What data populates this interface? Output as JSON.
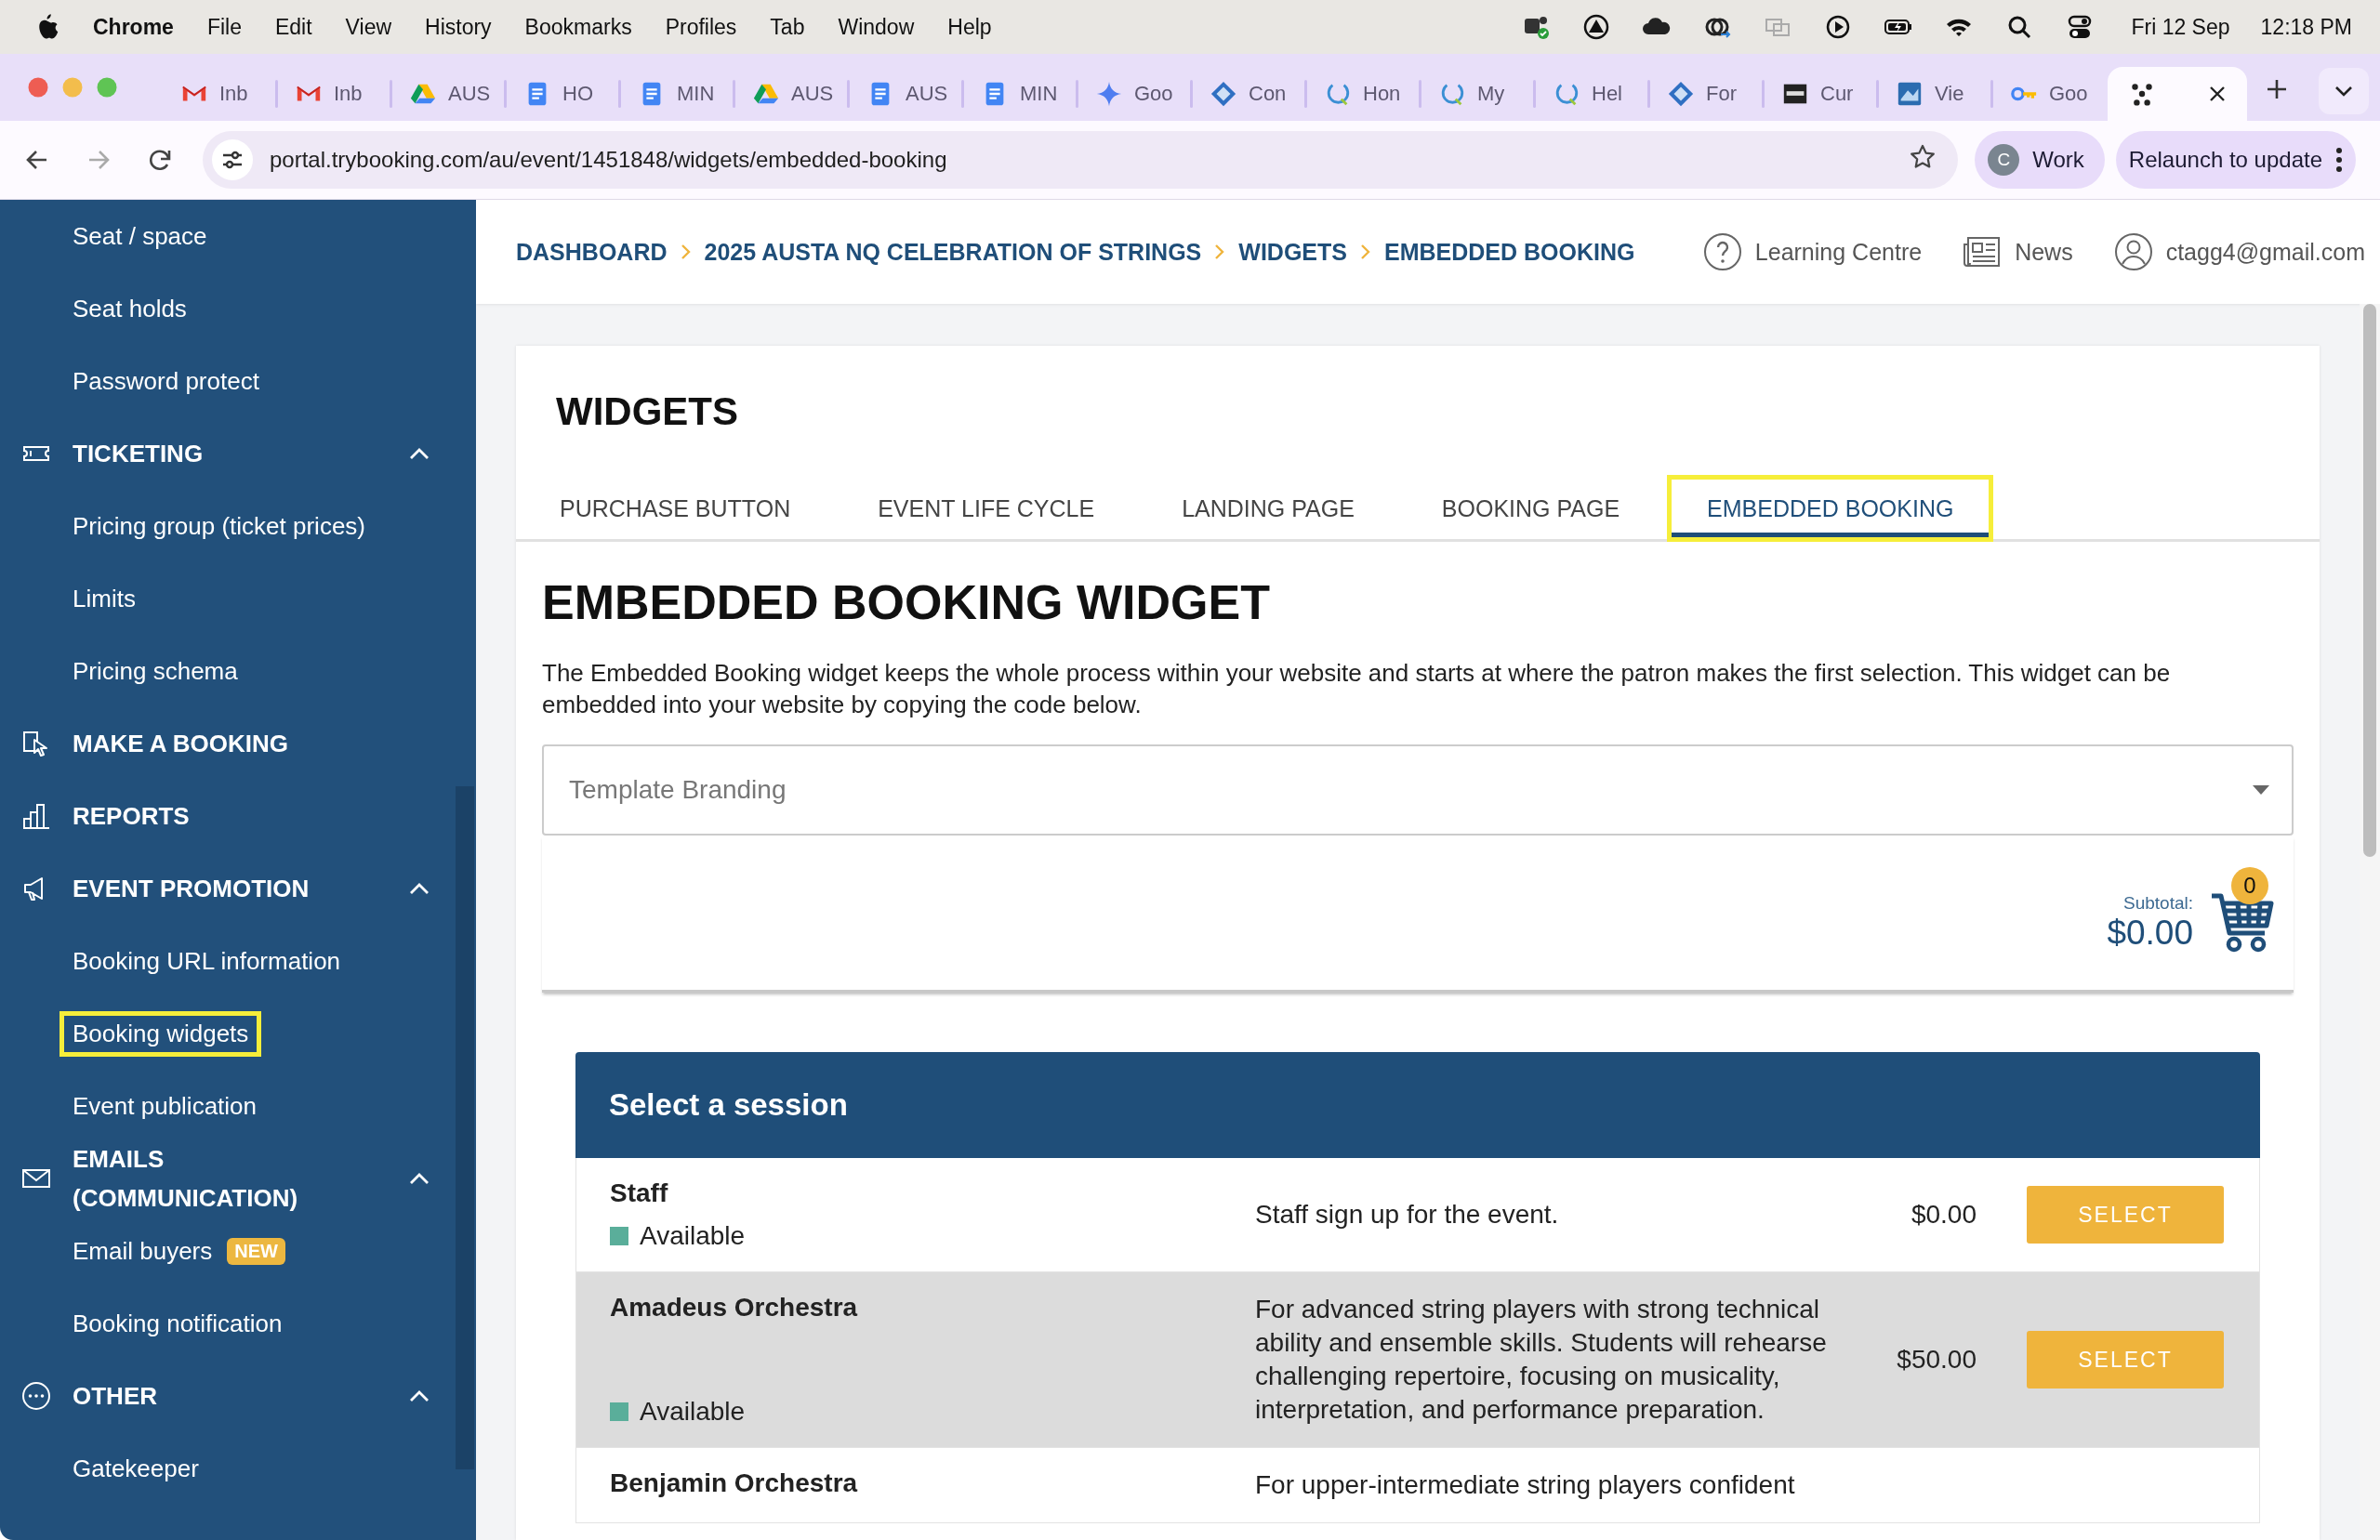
{
  "menu_bar": {
    "app": "Chrome",
    "menus": [
      "File",
      "Edit",
      "View",
      "History",
      "Bookmarks",
      "Profiles",
      "Tab",
      "Window",
      "Help"
    ],
    "date": "Fri 12 Sep",
    "time": "12:18 PM"
  },
  "browser_tabs": [
    {
      "title": "Inb",
      "selected": false
    },
    {
      "title": "Inb",
      "selected": false
    },
    {
      "title": "AUS",
      "selected": false
    },
    {
      "title": "HO",
      "selected": false
    },
    {
      "title": "MIN",
      "selected": false
    },
    {
      "title": "AUS",
      "selected": false
    },
    {
      "title": "AUS",
      "selected": false
    },
    {
      "title": "MIN",
      "selected": false
    },
    {
      "title": "Goo",
      "selected": false
    },
    {
      "title": "Con",
      "selected": false
    },
    {
      "title": "Hon",
      "selected": false
    },
    {
      "title": "My",
      "selected": false
    },
    {
      "title": "Hel",
      "selected": false
    },
    {
      "title": "For",
      "selected": false
    },
    {
      "title": "Cur",
      "selected": false
    },
    {
      "title": "Vie",
      "selected": false
    },
    {
      "title": "Goo",
      "selected": false
    },
    {
      "selected": true
    }
  ],
  "address_bar": {
    "url": "portal.trybooking.com/au/event/1451848/widgets/embedded-booking",
    "profile_initial": "C",
    "profile_name": "Work",
    "update_button": "Relaunch to update"
  },
  "sidebar": {
    "items": [
      {
        "kind": "link",
        "label": "Seat / space",
        "highlighted": false
      },
      {
        "kind": "link",
        "label": "Seat holds",
        "highlighted": false
      },
      {
        "kind": "link",
        "label": "Password protect",
        "highlighted": false
      },
      {
        "kind": "section",
        "label": "TICKETING",
        "expanded": true,
        "children": [
          {
            "label": "Pricing group (ticket prices)",
            "highlighted": false
          },
          {
            "label": "Limits",
            "highlighted": false
          },
          {
            "label": "Pricing schema",
            "highlighted": false
          }
        ]
      },
      {
        "kind": "entry",
        "label": "MAKE A BOOKING"
      },
      {
        "kind": "entry",
        "label": "REPORTS"
      },
      {
        "kind": "section",
        "label": "EVENT PROMOTION",
        "expanded": true,
        "children": [
          {
            "label": "Booking URL information",
            "highlighted": false
          },
          {
            "label": "Booking widgets",
            "highlighted": true
          },
          {
            "label": "Event publication",
            "highlighted": false
          }
        ]
      },
      {
        "kind": "section",
        "label": "EMAILS (COMMUNICATION)",
        "expanded": true,
        "children": [
          {
            "label": "Email buyers",
            "badge": "NEW",
            "highlighted": false
          },
          {
            "label": "Booking notification",
            "highlighted": false
          }
        ]
      },
      {
        "kind": "section",
        "label": "OTHER",
        "expanded": true,
        "children": [
          {
            "label": "Gatekeeper",
            "highlighted": false
          }
        ]
      }
    ]
  },
  "breadcrumb": [
    "DASHBOARD",
    "2025 AUSTA NQ CELEBRATION OF STRINGS",
    "WIDGETS",
    "EMBEDDED BOOKING"
  ],
  "header_links": [
    "Learning Centre",
    "News",
    "ctagg4@gmail.com"
  ],
  "widgets": {
    "title": "WIDGETS",
    "tabs": [
      {
        "label": "PURCHASE BUTTON",
        "selected": false,
        "highlighted": false
      },
      {
        "label": "EVENT LIFE CYCLE",
        "selected": false,
        "highlighted": false
      },
      {
        "label": "LANDING PAGE",
        "selected": false,
        "highlighted": false
      },
      {
        "label": "BOOKING PAGE",
        "selected": false,
        "highlighted": false
      },
      {
        "label": "EMBEDDED BOOKING",
        "selected": true,
        "highlighted": true
      }
    ],
    "heading": "EMBEDDED BOOKING WIDGET",
    "description": "The Embedded Booking widget keeps the whole process within your website and starts at where the patron makes the first selection. This widget can be embedded into your website by copying the code below.",
    "template_select": {
      "placeholder": "Template Branding"
    },
    "cart": {
      "subtotal_label": "Subtotal:",
      "subtotal": "$0.00",
      "count": "0"
    },
    "sessions": {
      "title": "Select a session",
      "rows": [
        {
          "name": "Staff",
          "status": "Available",
          "description": "Staff sign up for the event.",
          "price": "$0.00",
          "button": "SELECT"
        },
        {
          "name": "Amadeus Orchestra",
          "status": "Available",
          "description": "For advanced string players with strong technical ability and ensemble skills. Students will rehearse challenging repertoire, focusing on musicality, interpretation, and performance preparation.",
          "price": "$50.00",
          "button": "SELECT"
        },
        {
          "name": "Benjamin Orchestra",
          "description": "For upper-intermediate string players confident"
        }
      ]
    }
  }
}
